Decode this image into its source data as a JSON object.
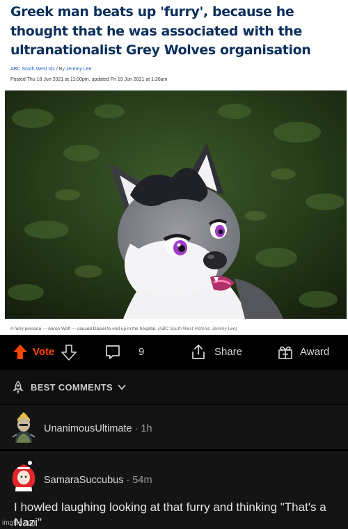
{
  "article": {
    "headline": "Greek man beats up 'furry', because he thought that he was associated with the ultranationalist Grey Wolves organisation",
    "source": "ABC South West Vic",
    "byline_sep": " / By ",
    "author": "Jeremy Lee",
    "posted": "Posted Thu 18 Jun 2021 at 11:00pm, updated Fri 19 Jun 2021 at 1:26am",
    "caption": "A furry persona — Aaron Wolf — caused Daniel to end up in the hospital.",
    "caption_credit": "(ABC South West Victoria: Jeremy Lee)"
  },
  "actions": {
    "vote_label": "Vote",
    "comment_count": "9",
    "share_label": "Share",
    "award_label": "Award"
  },
  "sort": {
    "label": "BEST COMMENTS"
  },
  "comments": [
    {
      "username": "UnanimousUltimate",
      "meta": " · 1h"
    },
    {
      "username": "SamaraSuccubus",
      "meta": " · 54m",
      "text": "I howled laughing looking at that furry and thinking \"That's a Nazi\""
    }
  ],
  "watermark": "imgflip.com",
  "colors": {
    "upvote": "#ff4500",
    "headline": "#0b2f5c",
    "bg": "#000000",
    "comment_bg": "#141415"
  }
}
